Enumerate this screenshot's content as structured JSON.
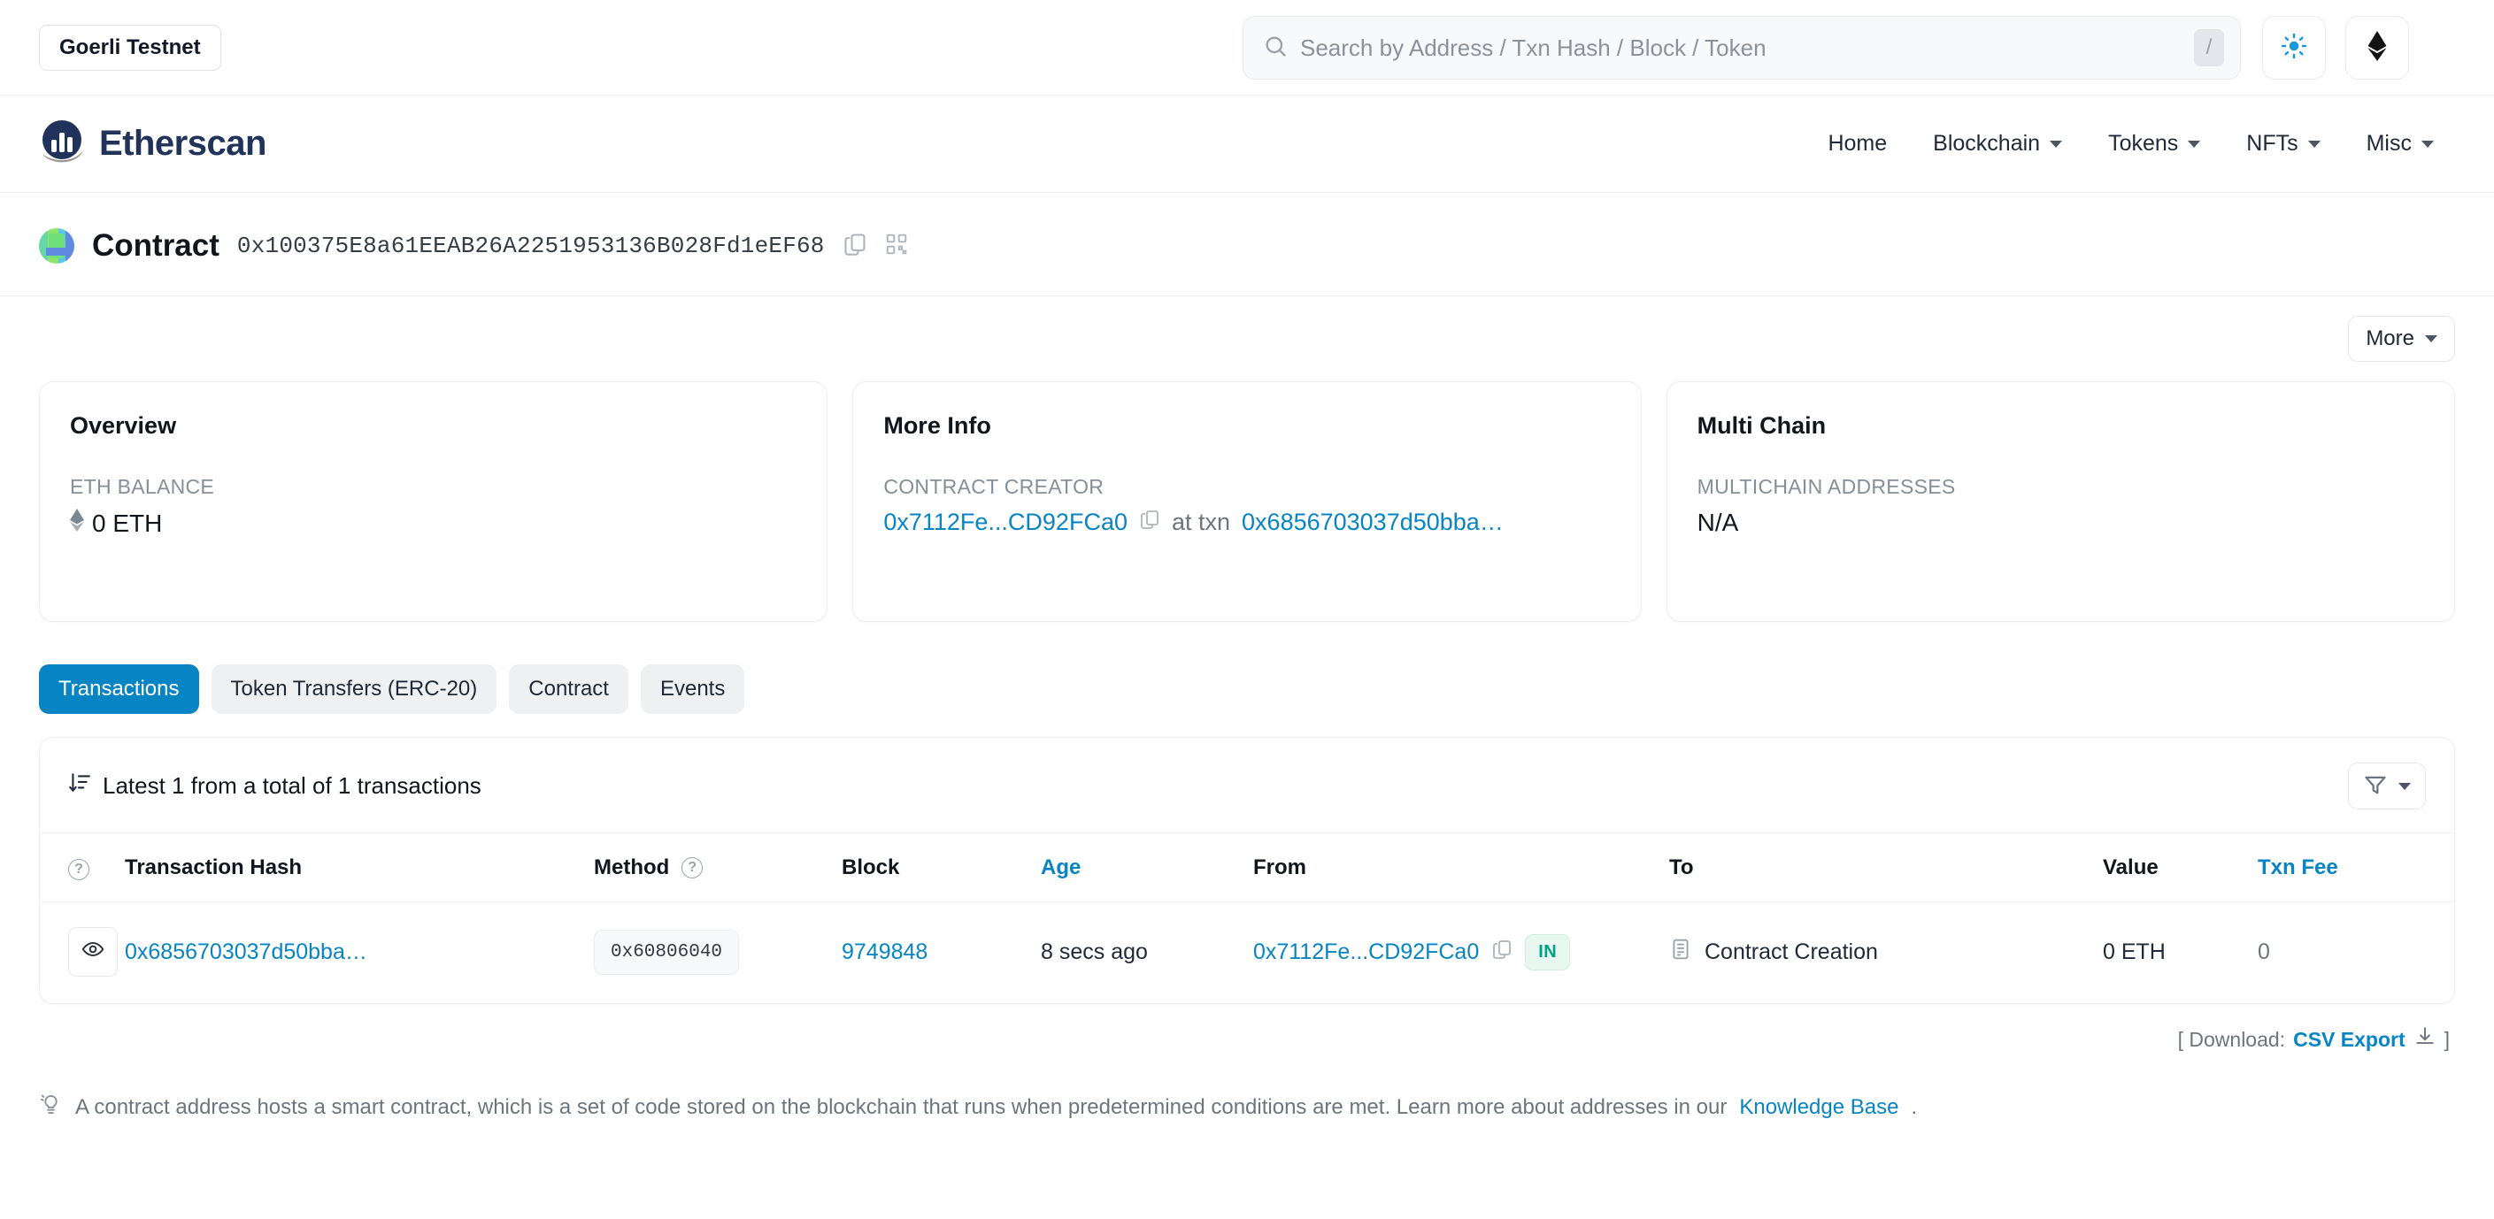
{
  "topbar": {
    "network_label": "Goerli Testnet",
    "search": {
      "placeholder": "Search by Address / Txn Hash / Block / Token",
      "value": "",
      "shortcut_key": "/"
    },
    "theme_icon": "sun-icon",
    "chain_icon": "ethereum-diamond-icon"
  },
  "nav": {
    "brand": "Etherscan",
    "links": [
      {
        "label": "Home",
        "has_caret": false
      },
      {
        "label": "Blockchain",
        "has_caret": true
      },
      {
        "label": "Tokens",
        "has_caret": true
      },
      {
        "label": "NFTs",
        "has_caret": true
      },
      {
        "label": "Misc",
        "has_caret": true
      }
    ]
  },
  "page_header": {
    "title": "Contract",
    "address": "0x100375E8a61EEAB26A2251953136B028Fd1eEF68",
    "copy_icon": "copy-icon",
    "qr_icon": "qr-code-icon"
  },
  "toolbar": {
    "more_label": "More"
  },
  "cards": {
    "overview": {
      "title": "Overview",
      "label": "ETH BALANCE",
      "value": "0 ETH"
    },
    "more_info": {
      "title": "More Info",
      "label": "CONTRACT CREATOR",
      "creator": "0x7112Fe...CD92FCa0",
      "at_txn_text": "at txn",
      "creation_txn": "0x6856703037d50bba…"
    },
    "multi_chain": {
      "title": "Multi Chain",
      "label": "MULTICHAIN ADDRESSES",
      "value": "N/A"
    }
  },
  "tabs": [
    {
      "label": "Transactions",
      "active": true
    },
    {
      "label": "Token Transfers (ERC-20)",
      "active": false
    },
    {
      "label": "Contract",
      "active": false
    },
    {
      "label": "Events",
      "active": false
    }
  ],
  "tx_panel": {
    "summary": "Latest 1 from a total of 1 transactions",
    "sort_icon": "sort-descending-icon",
    "filter_icon": "funnel-icon",
    "columns": [
      {
        "label": "",
        "help": true
      },
      {
        "label": "Transaction Hash",
        "help": false
      },
      {
        "label": "Method",
        "help": true
      },
      {
        "label": "Block",
        "help": false
      },
      {
        "label": "Age",
        "help": false,
        "sortable": true
      },
      {
        "label": "From",
        "help": false
      },
      {
        "label": "To",
        "help": false
      },
      {
        "label": "Value",
        "help": false
      },
      {
        "label": "Txn Fee",
        "help": false,
        "sortable": true
      }
    ],
    "rows": [
      {
        "hash": "0x6856703037d50bba…",
        "method": "0x60806040",
        "block": "9749848",
        "age": "8 secs ago",
        "from": "0x7112Fe...CD92FCa0",
        "direction": "IN",
        "to": "Contract Creation",
        "value": "0 ETH",
        "fee": "0"
      }
    ],
    "download_prefix": "[ Download:",
    "download_label": "CSV Export",
    "download_suffix": "]"
  },
  "footnote": {
    "icon": "lightbulb-icon",
    "text_before": "A contract address hosts a smart contract, which is a set of code stored on the blockchain that runs when predetermined conditions are met. Learn more about addresses in our",
    "link": "Knowledge Base",
    "text_after": "."
  },
  "colors": {
    "accent": "#0784c3",
    "brand_navy": "#21325b",
    "success": "#00a186",
    "muted": "#6c757d"
  }
}
